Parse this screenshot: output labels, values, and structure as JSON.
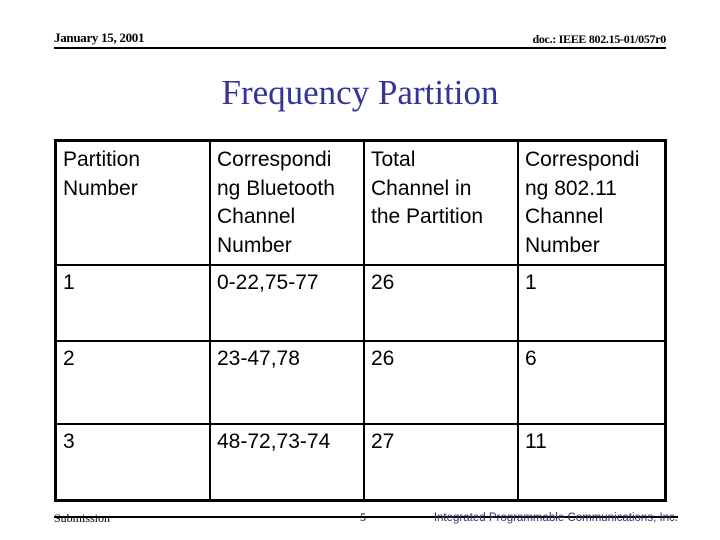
{
  "header": {
    "date": "January 15, 2001",
    "doc_id": "doc.: IEEE 802.15-01/057r0"
  },
  "title": "Frequency Partition",
  "colors": {
    "title": "#333399",
    "footer_company": "#333366"
  },
  "table": {
    "columns": [
      "Partition Number",
      "Correspondi ng Bluetooth Channel Number",
      "Total Channel in the Partition",
      "Correspondi ng 802.11 Channel Number"
    ],
    "header_lines": [
      [
        "Partition",
        "Number"
      ],
      [
        "Correspondi",
        "ng Bluetooth",
        "Channel",
        "Number"
      ],
      [
        "Total",
        "Channel in",
        "the Partition"
      ],
      [
        "Correspondi",
        "ng 802.11",
        "Channel",
        "Number"
      ]
    ],
    "rows": [
      [
        "1",
        "0-22,75-77",
        "26",
        "1"
      ],
      [
        "2",
        "23-47,78",
        "26",
        "6"
      ],
      [
        "3",
        "48-72,73-74",
        "27",
        "11"
      ]
    ]
  },
  "footer": {
    "left": "Submission",
    "page": "5",
    "company": "Integrated Programmable Communications, Inc."
  }
}
